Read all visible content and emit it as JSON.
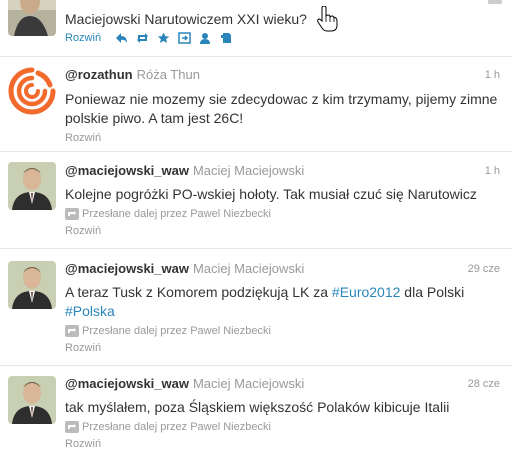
{
  "tweets": [
    {
      "text": "Maciejowski Narutowiczem XXI wieku?",
      "actions": {
        "expand": "Rozwiń",
        "icons": [
          "reply-icon",
          "retweet-icon",
          "favorite-icon",
          "open-icon",
          "follow-icon",
          "evernote-icon"
        ]
      }
    },
    {
      "username": "rozathun",
      "fullname": "Róża Thun",
      "time": "1 h",
      "text": "Poniewaz nie mozemy sie zdecydowac z kim trzymamy, pijemy zimne polskie piwo. A tam jest 26C!",
      "expand": "Rozwiń"
    },
    {
      "username": "maciejowski_waw",
      "fullname": "Maciej Maciejowski",
      "time": "1 h",
      "text": "Kolejne pogróżki PO-wskiej hołoty. Tak musiał czuć się Narutowicz",
      "retweet": "Przesłane dalej przez Pawel Niezbecki",
      "expand": "Rozwiń"
    },
    {
      "username": "maciejowski_waw",
      "fullname": "Maciej Maciejowski",
      "time": "29 cze",
      "text_before": "A teraz Tusk z Komorem podziękują LK za ",
      "hashtag1": "#Euro2012",
      "text_middle": " dla Polski",
      "hashtag2": "#Polska",
      "retweet": "Przesłane dalej przez Pawel Niezbecki",
      "expand": "Rozwiń"
    },
    {
      "username": "maciejowski_waw",
      "fullname": "Maciej Maciejowski",
      "time": "28 cze",
      "text": "tak myślałem, poza Śląskiem większość Polaków kibicuje Italii",
      "retweet": "Przesłane dalej przez Pawel Niezbecki",
      "expand": "Rozwiń"
    }
  ],
  "at_symbol": "@",
  "colors": {
    "link": "#2a86ba",
    "muted": "#999999",
    "text": "#333333",
    "logo": "#f26a2c"
  }
}
